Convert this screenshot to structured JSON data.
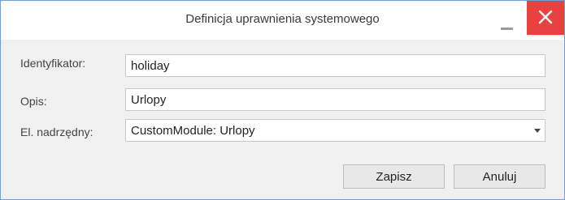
{
  "dialog": {
    "title": "Definicja uprawnienia systemowego"
  },
  "form": {
    "identifier_label": "Identyfikator:",
    "identifier_value": "holiday",
    "description_label": "Opis:",
    "description_value": "Urlopy",
    "parent_label": "El. nadrzędny:",
    "parent_value": "CustomModule: Urlopy"
  },
  "actions": {
    "save_label": "Zapisz",
    "cancel_label": "Anuluj"
  },
  "colors": {
    "close_button": "#e8413f",
    "border": "#7a9ec9",
    "background": "#f0f0f0"
  },
  "icons": {
    "minimize": "minimize-icon",
    "close": "close-icon",
    "dropdown": "chevron-down-icon"
  }
}
